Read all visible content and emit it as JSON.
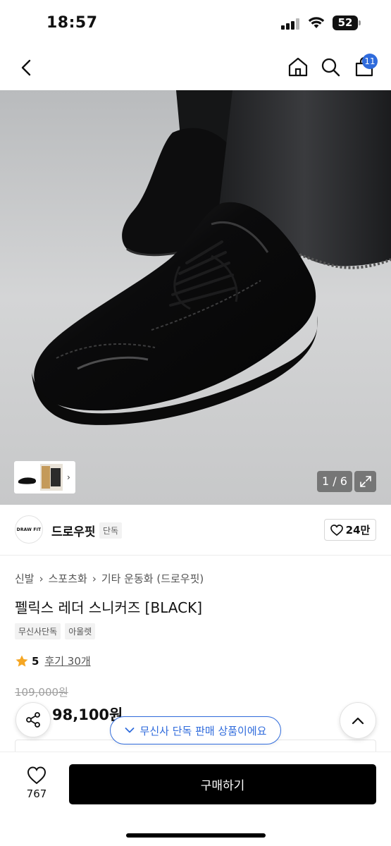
{
  "status_bar": {
    "time": "18:57",
    "battery_level": "52",
    "icons": [
      "cellular-signal-icon",
      "wifi-icon",
      "battery-icon"
    ]
  },
  "header": {
    "icons": [
      "back-arrow-icon",
      "home-icon",
      "search-icon",
      "cart-icon"
    ],
    "cart_badge": "11"
  },
  "gallery": {
    "current_page": 1,
    "total_pages": 6,
    "counter_text": "1 / 6",
    "thumbnail_arrow": "›"
  },
  "brand": {
    "logo_text": "DRAW FIT",
    "name": "드로우핏",
    "tag": "단독",
    "like_count": "24만"
  },
  "product": {
    "breadcrumb": [
      "신발",
      "스포츠화",
      "기타 운동화 (드로우핏)"
    ],
    "title": "펠릭스 레더 스니커즈 [BLACK]",
    "tags": [
      "무신사단독",
      "아울렛"
    ],
    "rating": "5",
    "review_text": "후기 30개",
    "original_price": "109,000원",
    "sale_price": "98,100원"
  },
  "floating": {
    "exclusive_label": "무신사 단독 판매 상품이에요"
  },
  "bottom_bar": {
    "wish_count": "767",
    "buy_label": "구매하기"
  },
  "colors": {
    "accent_blue": "#2f6bdc",
    "discount_red": "#ef3a30",
    "star": "#f5a623",
    "buy_button": "#000000"
  }
}
